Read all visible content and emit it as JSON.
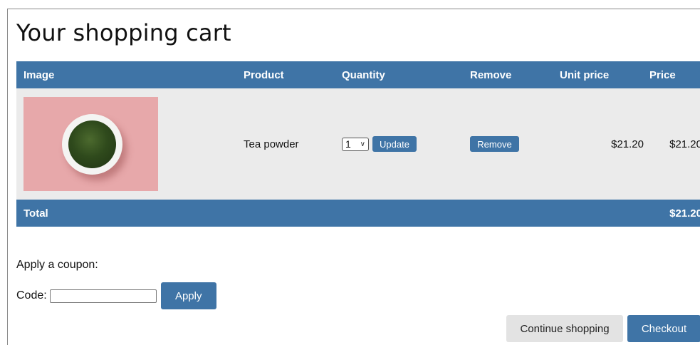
{
  "page": {
    "title": "Your shopping cart"
  },
  "colors": {
    "accent": "#3f74a6",
    "row_bg": "#ebebeb",
    "secondary_button": "#e3e3e3"
  },
  "cart": {
    "columns": [
      "Image",
      "Product",
      "Quantity",
      "Remove",
      "Unit price",
      "Price"
    ],
    "items": [
      {
        "image_alt": "bowl-of-tea-powder-image",
        "product": "Tea powder",
        "quantity": "1",
        "update_label": "Update",
        "remove_label": "Remove",
        "unit_price": "$21.20",
        "price": "$21.20"
      }
    ],
    "total_label": "Total",
    "total_value": "$21.20"
  },
  "coupon": {
    "heading": "Apply a coupon:",
    "code_label": "Code:",
    "code_value": "",
    "apply_label": "Apply"
  },
  "actions": {
    "continue_label": "Continue shopping",
    "checkout_label": "Checkout"
  }
}
